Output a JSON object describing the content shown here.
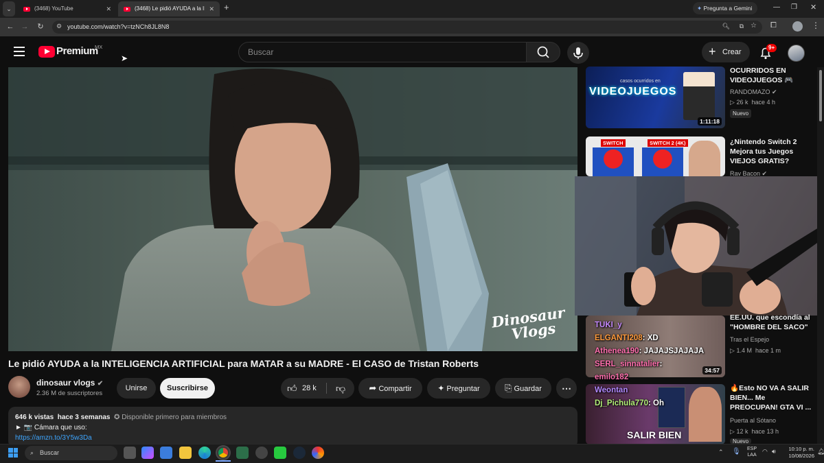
{
  "browser": {
    "tabs": [
      {
        "label": "(3468) YouTube"
      },
      {
        "label": "(3468) Le pidió AYUDA a la INTE"
      }
    ],
    "gemini_label": "Pregunta a Gemini",
    "url": "youtube.com/watch?v=tzNCh8JL8N8"
  },
  "yt": {
    "logo_text": "Premium",
    "country": "MX",
    "search_placeholder": "Buscar",
    "create_label": "Crear",
    "notif_badge": "9+"
  },
  "video": {
    "watermark_line1": "Dinosaur",
    "watermark_line2": "Vlogs",
    "title": "Le pidió AYUDA a la INTELIGENCIA ARTIFICIAL para MATAR a su MADRE - El CASO de Tristan Roberts",
    "channel": "dinosaur vlogs",
    "subscribers": "2.36 M de suscriptores",
    "join_label": "Unirse",
    "subscribe_label": "Suscribirse",
    "likes": "28 k",
    "share_label": "Compartir",
    "ask_label": "Preguntar",
    "save_label": "Guardar",
    "views": "646 k vistas",
    "age": "hace 3 semanas",
    "members_note": "Disponible primero para miembros",
    "desc_line": "► 📷 Cámara que uso:",
    "desc_link": "https://amzn.to/3Y5w3Da"
  },
  "sidebar": [
    {
      "title_l1": "OCURRIDOS EN",
      "title_l2": "VIDEOJUEGOS 🎮",
      "title_l3": "",
      "channel": "RANDOMAZO",
      "views": "26 k",
      "age": "hace 4 h",
      "badge": "Nuevo",
      "duration": "1:11:18",
      "thumb_text": "VIDEOJUEGOS",
      "thumb_small": "casos ocurridos en"
    },
    {
      "title_l1": "¿Nintendo Switch 2",
      "title_l2": "Mejora tus Juegos",
      "title_l3": "VIEJOS GRATIS?",
      "channel": "Ray Bacon",
      "thumb_a": "SWITCH",
      "thumb_b": "SWITCH 2 (4K)"
    },
    {
      "title_l1": "EE.UU. que escondía al",
      "title_l2": "\"HOMBRE DEL SACO\"",
      "title_l3": "",
      "channel": "Tras el Espejo",
      "views": "1.4 M",
      "age": "hace 1 m",
      "duration": "34:57"
    },
    {
      "title_l1": "🔥Esto NO VA A SALIR",
      "title_l2": "BIEN... Me",
      "title_l3": "PREOCUPAN! GTA VI ...",
      "channel": "Puerta al Sótano",
      "views": "12 k",
      "age": "hace 13 h",
      "badge": "Nuevo",
      "thumb_text": "SALIR BIEN"
    }
  ],
  "chat": [
    {
      "user": "TUKI_y",
      "msg": ""
    },
    {
      "user": "ELGANTI208",
      "msg": ": XD"
    },
    {
      "user": "Athenea190",
      "msg": ": JAJAJSJAJAJA"
    },
    {
      "user": "SERL_sinnatalier",
      "msg": ":"
    },
    {
      "user": "emilo182",
      "msg": ""
    },
    {
      "user": "Weontan",
      "msg": ""
    },
    {
      "user": "Dj_Pichula770",
      "msg": ": Oh"
    }
  ],
  "taskbar": {
    "search_placeholder": "Buscar",
    "lang1": "ESP",
    "lang2": "LAA",
    "time": "10:10 p. m.",
    "date": "10/08/2026"
  },
  "colors": {
    "yt_red": "#ff0033",
    "link": "#3ea6ff",
    "subscribe_bg": "#f1f1f1"
  }
}
